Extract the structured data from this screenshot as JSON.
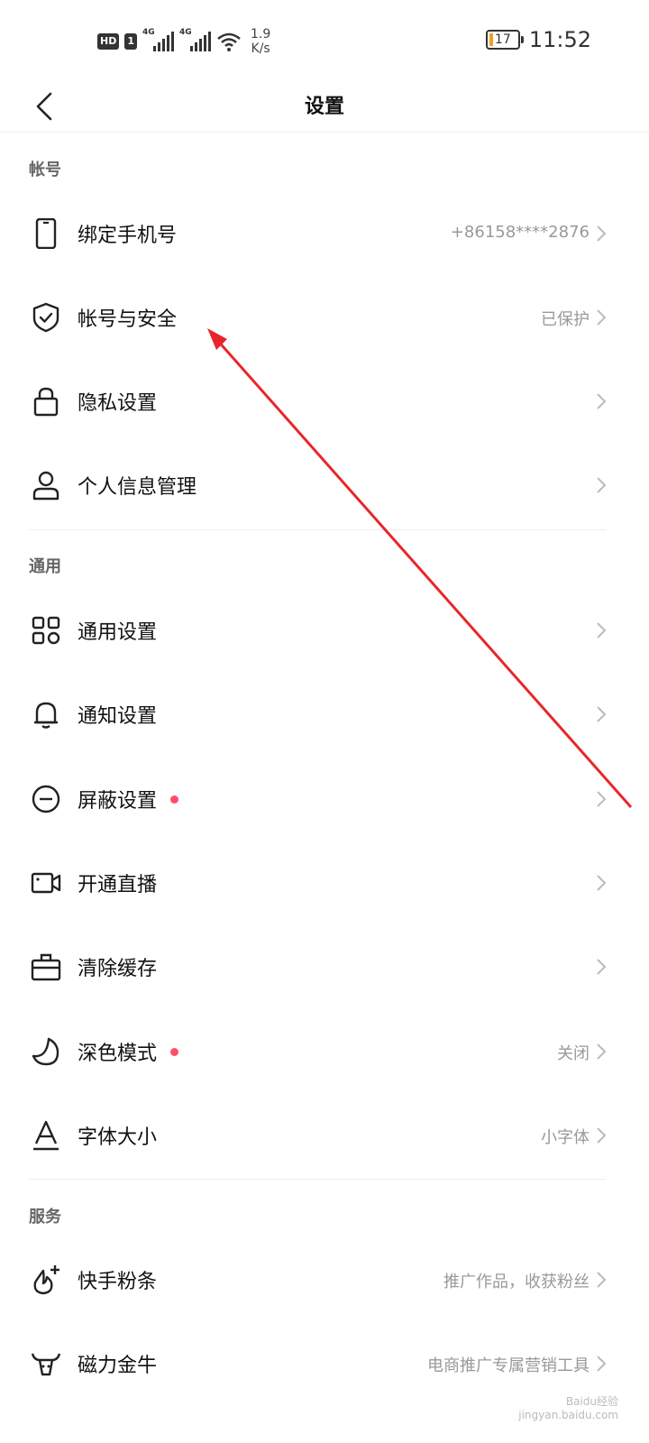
{
  "status": {
    "hd": "HD",
    "sim": "1",
    "net1": "4G",
    "net2": "4G",
    "speed_top": "1.9",
    "speed_bottom": "K/s",
    "battery": "17",
    "time": "11:52"
  },
  "header": {
    "title": "设置"
  },
  "sections": {
    "account": "帐号",
    "general": "通用",
    "service": "服务"
  },
  "rows": [
    {
      "label": "绑定手机号",
      "value": "+86158****2876"
    },
    {
      "label": "帐号与安全",
      "value": "已保护"
    },
    {
      "label": "隐私设置",
      "value": ""
    },
    {
      "label": "个人信息管理",
      "value": ""
    },
    {
      "label": "通用设置",
      "value": ""
    },
    {
      "label": "通知设置",
      "value": ""
    },
    {
      "label": "屏蔽设置",
      "value": ""
    },
    {
      "label": "开通直播",
      "value": ""
    },
    {
      "label": "清除缓存",
      "value": ""
    },
    {
      "label": "深色模式",
      "value": "关闭"
    },
    {
      "label": "字体大小",
      "value": "小字体"
    },
    {
      "label": "快手粉条",
      "value": "推广作品，收获粉丝"
    },
    {
      "label": "磁力金牛",
      "value": "电商推广专属营销工具"
    }
  ],
  "watermark": {
    "line1": "Baidu经验",
    "line2": "jingyan.baidu.com"
  },
  "colors": {
    "accent_dot": "#ff4d6a",
    "annotation_arrow": "#e8262a"
  }
}
